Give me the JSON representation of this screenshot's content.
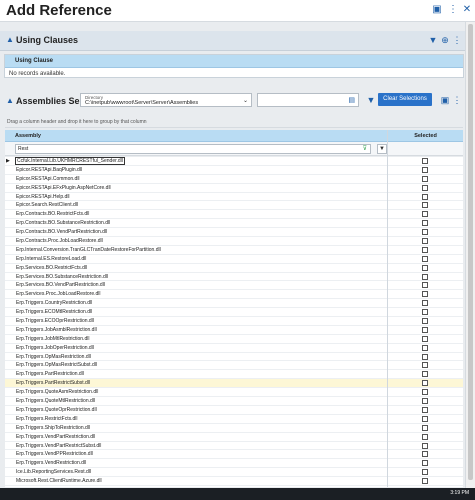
{
  "window": {
    "title": "Add Reference"
  },
  "using_clauses": {
    "section_label": "Using Clauses",
    "column": "Using Clause",
    "empty_text": "No records available."
  },
  "assemblies": {
    "section_label": "Assemblies Selection",
    "directory_label": "Directory",
    "directory_value": "C:\\inetpub\\wwwroot\\Server\\Server\\Assemblies",
    "clear_button": "Clear Selections",
    "group_hint": "Drag a column header and drop it here to group by that column",
    "col_assembly": "Assembly",
    "col_selected": "Selected",
    "filter_value": "Rest",
    "rows": [
      "Ccfuk.Internal.Lib.UKHMRCRESTful_Sender.dll",
      "Epicor.RESTApi.BaqPlugin.dll",
      "Epicor.RESTApi.Common.dll",
      "Epicor.RESTApi.EFxPlugin.AspNetCore.dll",
      "Epicor.RESTApi.Help.dll",
      "Epicor.Search.RestClient.dll",
      "Erp.Contracts.BO.RestrictFcts.dll",
      "Erp.Contracts.BO.SubstanceRestriction.dll",
      "Erp.Contracts.BO.VendPartRestriction.dll",
      "Erp.Contracts.Proc.JobLoadRestore.dll",
      "Erp.Internal.Conversion.TranGLCTranDateRestoreForPartition.dll",
      "Erp.Internal.ES.RestoreLoad.dll",
      "Erp.Services.BO.RestrictFcts.dll",
      "Erp.Services.BO.SubstanceRestriction.dll",
      "Erp.Services.BO.VendPartRestriction.dll",
      "Erp.Services.Proc.JobLoadRestore.dll",
      "Erp.Triggers.CountryRestriction.dll",
      "Erp.Triggers.ECOMtlRestriction.dll",
      "Erp.Triggers.ECOOprRestriction.dll",
      "Erp.Triggers.JobAsmblRestriction.dll",
      "Erp.Triggers.JobMtlRestriction.dll",
      "Erp.Triggers.JobOperRestriction.dll",
      "Erp.Triggers.OpMasRestriction.dll",
      "Erp.Triggers.OpMasRestrictSubst.dll",
      "Erp.Triggers.PartRestriction.dll",
      "Erp.Triggers.PartRestrictSubst.dll",
      "Erp.Triggers.QuoteAsmRestriction.dll",
      "Erp.Triggers.QuoteMtlRestriction.dll",
      "Erp.Triggers.QuoteOprRestriction.dll",
      "Erp.Triggers.RestrictFcts.dll",
      "Erp.Triggers.ShipToRestriction.dll",
      "Erp.Triggers.VendPartRestriction.dll",
      "Erp.Triggers.VendPartRestrictSubst.dll",
      "Erp.Triggers.VendPPRestriction.dll",
      "Erp.Triggers.VendRestriction.dll",
      "Ice.Lib.ReportingServices.Rest.dll",
      "Microsoft.Rest.ClientRuntime.Azure.dll"
    ]
  },
  "taskbar": {
    "clock": "3:19 PM"
  },
  "colors": {
    "accent": "#2a72c9",
    "grid_header": "#b9dcf3",
    "highlight_row": "#fdf7d6"
  }
}
